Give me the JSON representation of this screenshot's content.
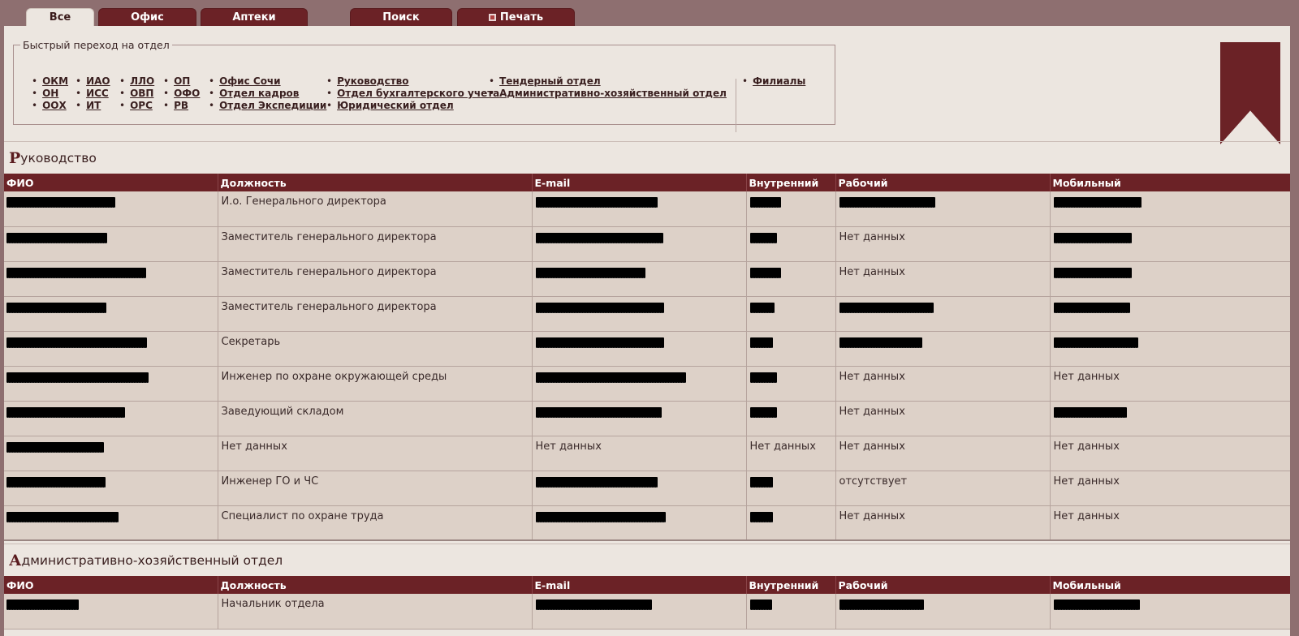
{
  "tabs": [
    {
      "label": "Все",
      "active": true
    },
    {
      "label": "Офис",
      "active": false
    },
    {
      "label": "Аптеки",
      "active": false
    },
    {
      "label": "Поиск",
      "active": false
    },
    {
      "label": "Печать",
      "active": false,
      "icon": "print-icon"
    }
  ],
  "quick_nav": {
    "legend": "Быстрый переход на отдел",
    "col1": [
      "ОКМ",
      "ОН",
      "ООХ"
    ],
    "col2": [
      "ИАО",
      "ИСС",
      "ИТ"
    ],
    "col3": [
      "ЛЛО",
      "ОВП",
      "ОРС"
    ],
    "col4": [
      "ОП",
      "ОФО",
      "РВ"
    ],
    "col5": [
      "Офис Сочи",
      "Отдел кадров",
      "Отдел Экспедиции"
    ],
    "col6": [
      "Руководство",
      "Отдел бухгалтерского учета",
      "Юридический отдел"
    ],
    "col7": [
      "Тендерный отдел",
      "Административно-хозяйственный отдел"
    ],
    "col8": [
      "Филиалы"
    ]
  },
  "colors": {
    "header": "#6b2226",
    "row": "#ddd1c8",
    "panel": "#ece6e0",
    "frame": "#8e6f70"
  },
  "columns": [
    "ФИО",
    "Должность",
    "E-mail",
    "Внутренний",
    "Рабочий",
    "Мобильный"
  ],
  "sections": [
    {
      "title_cap": "Р",
      "title_rest": "уководство",
      "rows": [
        {
          "position": "И.о. Генерального директора",
          "email": "",
          "internal": "",
          "work": "",
          "mobile": ""
        },
        {
          "position": "Заместитель генерального директора",
          "email": "",
          "internal": "",
          "work": "Нет данных",
          "mobile": ""
        },
        {
          "position": "Заместитель генерального директора",
          "email": "",
          "internal": "",
          "work": "Нет данных",
          "mobile": ""
        },
        {
          "position": "Заместитель генерального директора",
          "email": "",
          "internal": "",
          "work": "",
          "mobile": ""
        },
        {
          "position": "Секретарь",
          "email": "",
          "internal": "",
          "work": "",
          "mobile": ""
        },
        {
          "position": "Инженер по охране окружающей среды",
          "email": "",
          "internal": "",
          "work": "Нет данных",
          "mobile": "Нет данных"
        },
        {
          "position": "Заведующий складом",
          "email": "",
          "internal": "",
          "work": "Нет данных",
          "mobile": ""
        },
        {
          "position": "Нет данных",
          "email": "Нет данных",
          "internal": "Нет данных",
          "work": "Нет данных",
          "mobile": "Нет данных"
        },
        {
          "position": "Инженер ГО и ЧС",
          "email": "",
          "internal": "",
          "work": "отсутствует",
          "mobile": "Нет данных"
        },
        {
          "position": "Специалист по охране труда",
          "email": "",
          "internal": "",
          "work": "Нет данных",
          "mobile": "Нет данных"
        }
      ]
    },
    {
      "title_cap": "А",
      "title_rest": "дминистративно-хозяйственный отдел",
      "rows": [
        {
          "position": "Начальник отдела",
          "email": "",
          "internal": "",
          "work": "",
          "mobile": ""
        }
      ]
    }
  ]
}
